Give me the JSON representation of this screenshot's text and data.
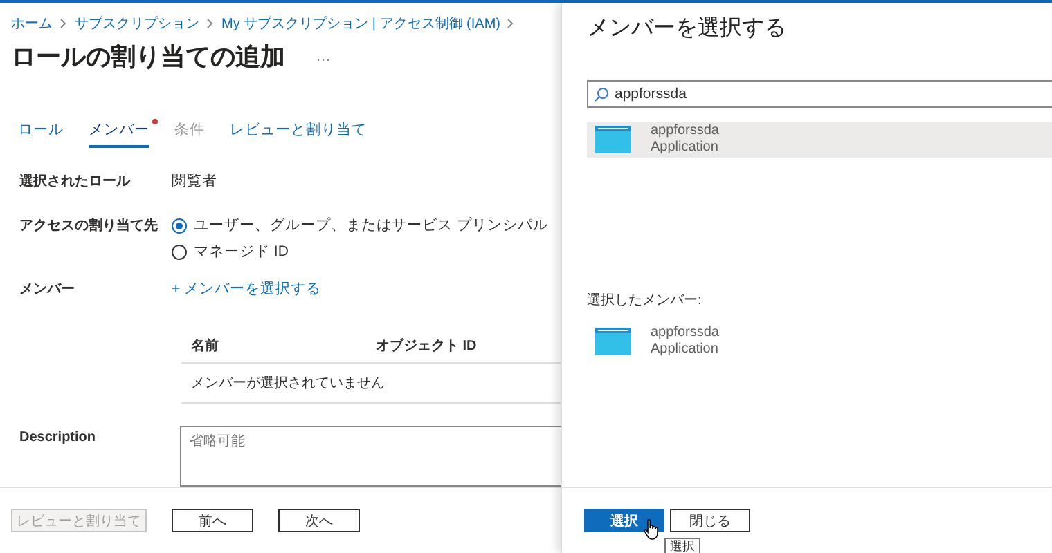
{
  "breadcrumb": [
    "ホーム",
    "サブスクリプション",
    "My サブスクリプション | アクセス制御 (IAM)"
  ],
  "title": "ロールの割り当ての追加",
  "more": "…",
  "tabs": [
    {
      "label": "ロール",
      "selected": false,
      "disabled": false,
      "required": false
    },
    {
      "label": "メンバー",
      "selected": true,
      "disabled": false,
      "required": true
    },
    {
      "label": "条件",
      "selected": false,
      "disabled": true,
      "required": false
    },
    {
      "label": "レビューと割り当て",
      "selected": false,
      "disabled": false,
      "required": false
    }
  ],
  "selected_role": {
    "label": "選択されたロール",
    "value": "閲覧者"
  },
  "assign_to": {
    "label": "アクセスの割り当て先",
    "options": [
      {
        "label": "ユーザー、グループ、またはサービス プリンシパル",
        "selected": true
      },
      {
        "label": "マネージド ID",
        "selected": false
      }
    ]
  },
  "members": {
    "label": "メンバー",
    "link": "+ メンバーを選択する",
    "columns": [
      "名前",
      "オブジェクト ID"
    ],
    "empty": "メンバーが選択されていません"
  },
  "description": {
    "label": "Description",
    "placeholder": "省略可能"
  },
  "footer_buttons": [
    {
      "label": "レビューと割り当て",
      "disabled": true
    },
    {
      "label": "前へ",
      "disabled": false
    },
    {
      "label": "次へ",
      "disabled": false
    }
  ],
  "panel": {
    "title": "メンバーを選択する",
    "search": "appforssda",
    "results": [
      {
        "name": "appforssda",
        "type": "Application",
        "selected": true
      }
    ],
    "selected_label": "選択したメンバー:",
    "selected_members": [
      {
        "name": "appforssda",
        "type": "Application"
      }
    ],
    "buttons": [
      {
        "label": "選択",
        "kind": "primary"
      },
      {
        "label": "閉じる",
        "kind": "default"
      }
    ],
    "tooltip": "選択"
  }
}
